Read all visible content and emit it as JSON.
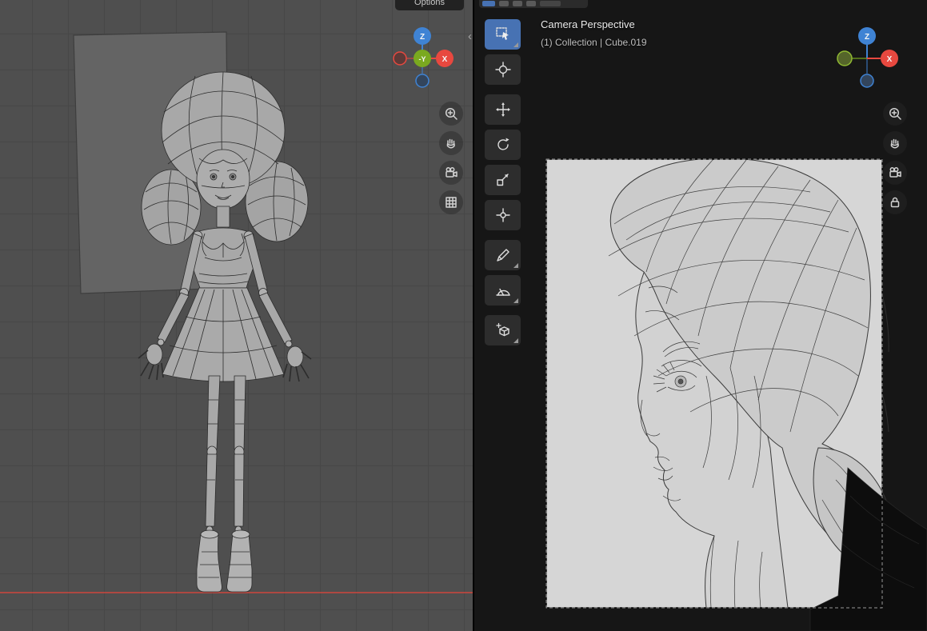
{
  "left_viewport": {
    "options_button": {
      "label": "Options"
    },
    "collapse_arrow": "‹",
    "gizmo": {
      "z_label": "Z",
      "x_label": "X",
      "center_label": "-Y"
    },
    "nav_icons": [
      "zoom-icon",
      "pan-hand-icon",
      "camera-view-icon",
      "grid-orthographic-icon"
    ]
  },
  "right_viewport": {
    "view_label": "Camera Perspective",
    "breadcrumb": "(1) Collection | Cube.019",
    "gizmo": {
      "z_label": "Z",
      "x_label": "X"
    },
    "toolbar_icons": [
      "select-box-tool",
      "cursor-tool",
      "move-tool",
      "rotate-tool",
      "scale-tool",
      "transform-tool",
      "annotate-tool",
      "measure-tool",
      "add-cube-tool"
    ],
    "nav_icons": [
      "zoom-icon",
      "pan-hand-icon",
      "camera-icon",
      "lock-icon"
    ],
    "partial_header_icons": [
      "editor-type-icon",
      "mode-icon",
      "mode-icon",
      "mode-icon"
    ]
  },
  "colors": {
    "axis_x": "#e8483f",
    "axis_y": "#7aa91f",
    "axis_z": "#3f83d4",
    "tool_active": "#4772b3",
    "camera_bg": "#d6d6d6",
    "grid_bg": "#4f4f4f"
  }
}
